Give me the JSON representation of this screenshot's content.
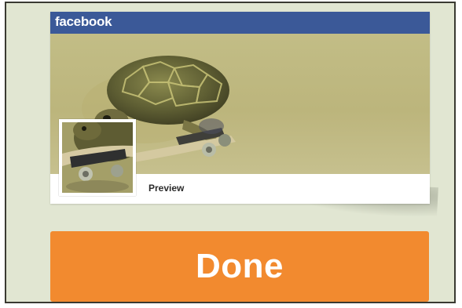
{
  "card": {
    "brand": "facebook",
    "preview_label": "Preview",
    "cover_image": "turtle-on-skateboard-photo",
    "profile_image": "turtle-on-skateboard-thumbnail"
  },
  "actions": {
    "done_label": "Done"
  },
  "colors": {
    "facebook_header": "#3b5998",
    "done_button": "#f28a2f",
    "background": "#e1e6d2"
  }
}
